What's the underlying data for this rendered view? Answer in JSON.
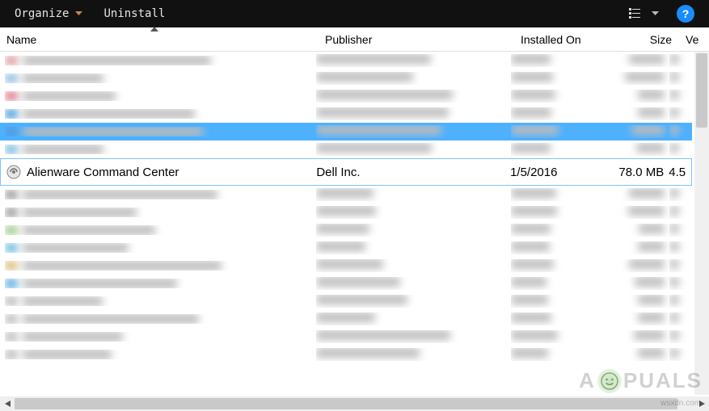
{
  "toolbar": {
    "organize_label": "Organize",
    "uninstall_label": "Uninstall"
  },
  "columns": {
    "name": "Name",
    "publisher": "Publisher",
    "installed": "Installed On",
    "size": "Size",
    "version": "Ve"
  },
  "focused_row": {
    "name": "Alienware Command Center",
    "publisher": "Dell Inc.",
    "installed": "1/5/2016",
    "size": "78.0 MB",
    "version": "4.5"
  },
  "blurred_rows_before": 6,
  "selected_index_before": 4,
  "blurred_rows_after": 10,
  "watermark_text_left": "A",
  "watermark_text_right": "PUALS",
  "source_text": "wsxdn.com",
  "blur_icon_colors": [
    "#d99",
    "#8bd",
    "#d78",
    "#49d",
    "#59d",
    "#7bd",
    "#999",
    "#999",
    "#9c8",
    "#6bd",
    "#db7",
    "#5ad",
    "#bbb",
    "#bbb",
    "#bbb",
    "#bbb"
  ]
}
